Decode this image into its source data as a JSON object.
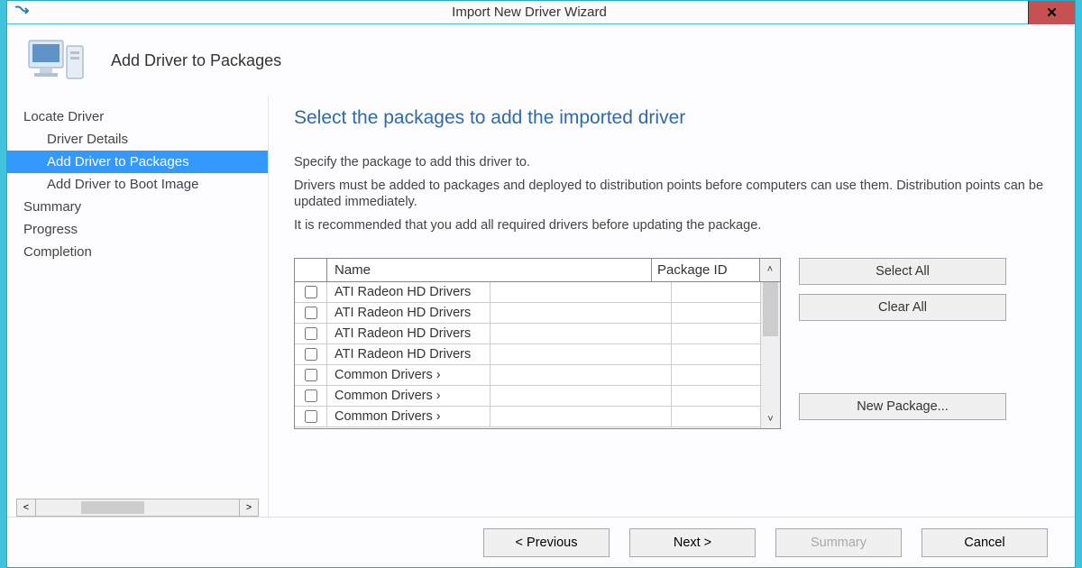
{
  "window": {
    "title": "Import New Driver Wizard"
  },
  "header": {
    "title": "Add Driver to Packages"
  },
  "sidebar": {
    "items": [
      {
        "label": "Locate Driver",
        "indent": false,
        "selected": false
      },
      {
        "label": "Driver Details",
        "indent": true,
        "selected": false
      },
      {
        "label": "Add Driver to Packages",
        "indent": true,
        "selected": true
      },
      {
        "label": "Add Driver to Boot Image",
        "indent": true,
        "selected": false
      },
      {
        "label": "Summary",
        "indent": false,
        "selected": false
      },
      {
        "label": "Progress",
        "indent": false,
        "selected": false
      },
      {
        "label": "Completion",
        "indent": false,
        "selected": false
      }
    ]
  },
  "content": {
    "title": "Select the packages to add the imported driver",
    "desc1": "Specify the package to add this driver to.",
    "desc2": "Drivers must be added to packages and deployed to distribution points before computers can use them.  Distribution points can be updated immediately.",
    "desc3": "It is recommended that you add all required drivers before updating the package."
  },
  "table": {
    "columns": {
      "name": "Name",
      "package_id": "Package ID"
    },
    "rows": [
      {
        "name": "ATI Radeon HD Drivers",
        "package_id": ""
      },
      {
        "name": "ATI Radeon HD Drivers",
        "package_id": ""
      },
      {
        "name": "ATI Radeon HD Drivers",
        "package_id": ""
      },
      {
        "name": "ATI Radeon HD Drivers",
        "package_id": ""
      },
      {
        "name": "Common Drivers ›",
        "package_id": ""
      },
      {
        "name": "Common Drivers ›",
        "package_id": ""
      },
      {
        "name": "Common Drivers ›",
        "package_id": ""
      }
    ]
  },
  "buttons": {
    "select_all": "Select All",
    "clear_all": "Clear All",
    "new_package": "New Package...",
    "previous": "< Previous",
    "next": "Next >",
    "summary": "Summary",
    "cancel": "Cancel"
  }
}
